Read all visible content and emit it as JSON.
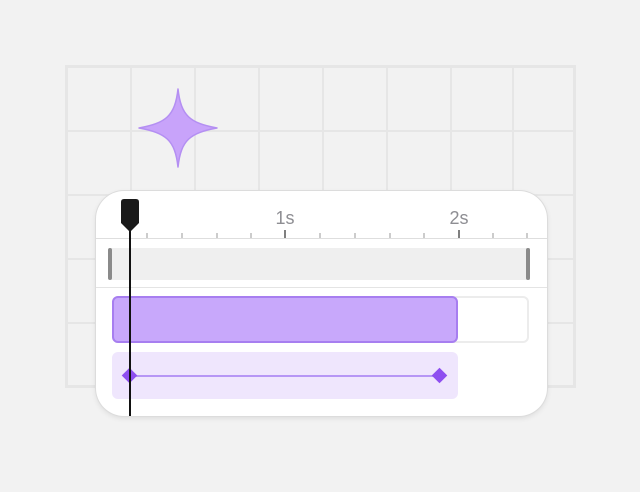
{
  "timeline": {
    "ruler_labels": [
      "1s",
      "2s"
    ]
  },
  "colors": {
    "accent": "#c8a8fb",
    "accent_border": "#a77ef0",
    "keyframe": "#8e4ff0",
    "keyframe_track": "#efe6fd",
    "playhead": "#1a1a1a"
  },
  "icons": {
    "canvas_object": "sparkle-icon",
    "playhead": "playhead-icon",
    "keyframe": "diamond-icon"
  }
}
